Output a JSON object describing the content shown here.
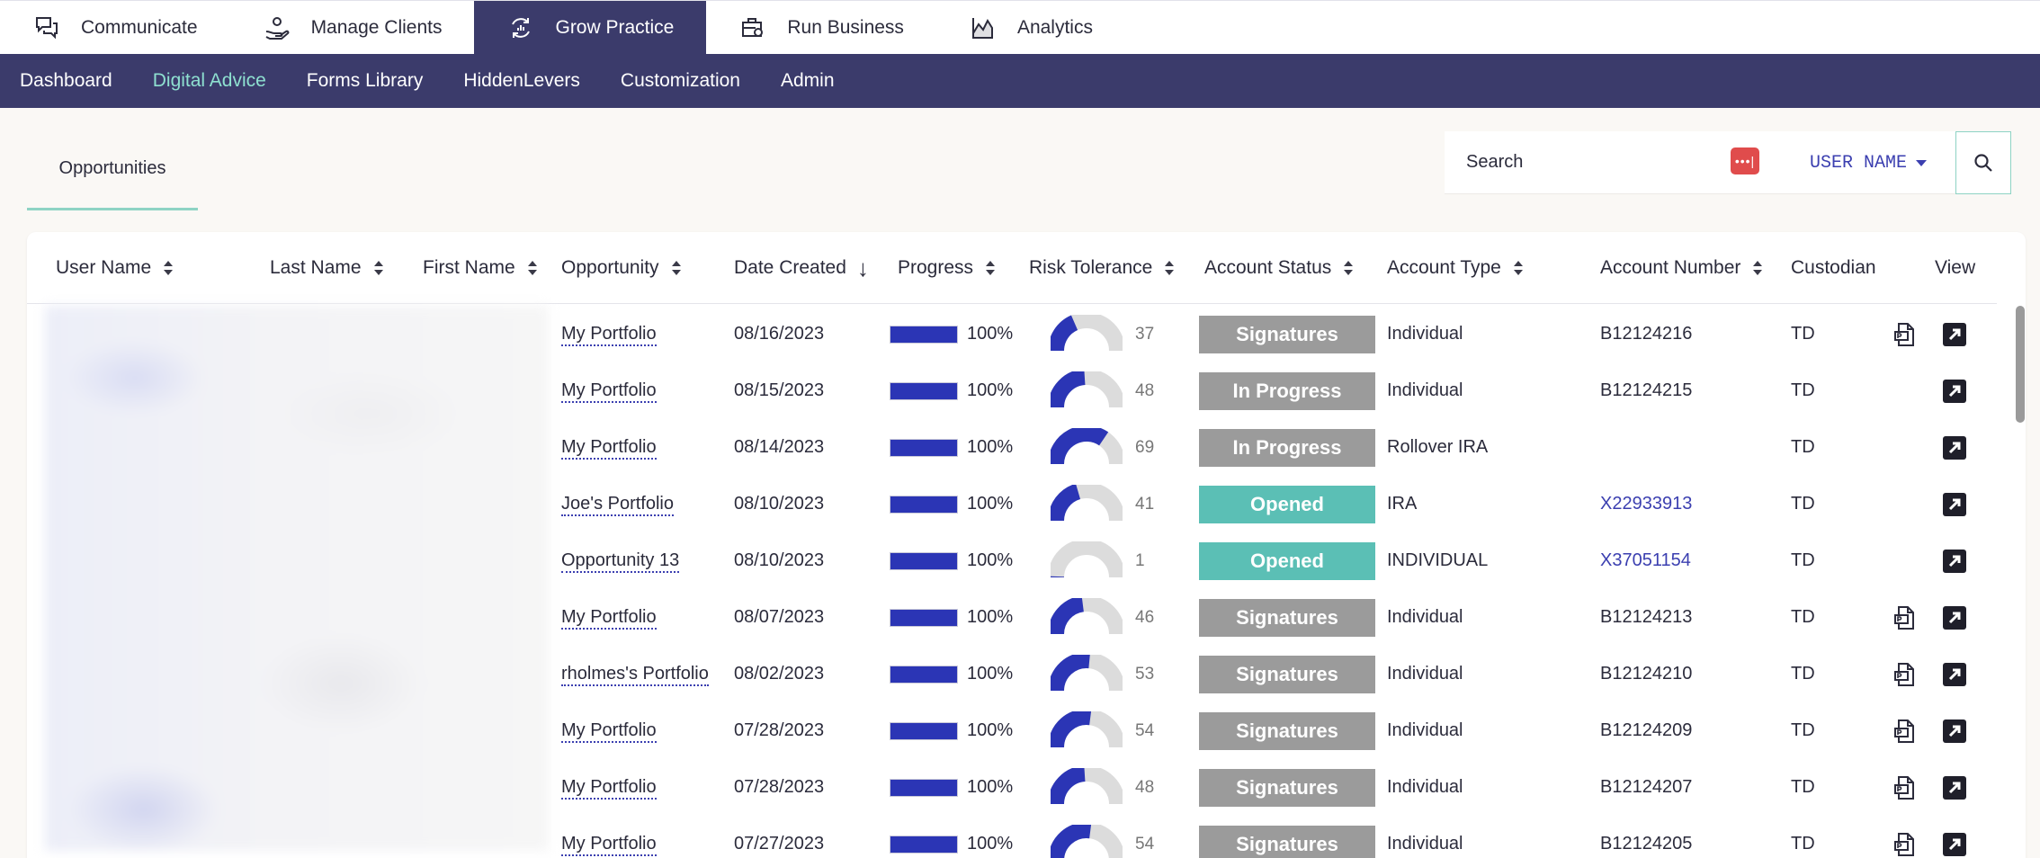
{
  "top_nav": {
    "tabs": [
      {
        "label": "Communicate",
        "icon": "chat-icon",
        "active": false
      },
      {
        "label": "Manage Clients",
        "icon": "hand-user-icon",
        "active": false
      },
      {
        "label": "Grow Practice",
        "icon": "growth-cycle-icon",
        "active": true
      },
      {
        "label": "Run Business",
        "icon": "business-gear-icon",
        "active": false
      },
      {
        "label": "Analytics",
        "icon": "analytics-chart-icon",
        "active": false
      }
    ]
  },
  "sub_nav": {
    "items": [
      {
        "label": "Dashboard",
        "active": false
      },
      {
        "label": "Digital Advice",
        "active": true
      },
      {
        "label": "Forms Library",
        "active": false
      },
      {
        "label": "HiddenLevers",
        "active": false
      },
      {
        "label": "Customization",
        "active": false
      },
      {
        "label": "Admin",
        "active": false
      }
    ]
  },
  "section_tab": {
    "label": "Opportunities"
  },
  "search": {
    "placeholder": "Search",
    "field": "USER NAME",
    "button_icon": "search-icon",
    "password_manager_icon": "password-manager-icon"
  },
  "table": {
    "columns": {
      "user_name": "User Name",
      "last_name": "Last Name",
      "first_name": "First Name",
      "opportunity": "Opportunity",
      "date_created": "Date Created",
      "progress": "Progress",
      "risk_tolerance": "Risk Tolerance",
      "account_status": "Account Status",
      "account_type": "Account Type",
      "account_number": "Account Number",
      "custodian": "Custodian",
      "view": "View"
    },
    "rows": [
      {
        "opportunity": "My Portfolio",
        "date": "08/16/2023",
        "progress": "100%",
        "risk": "37",
        "status": "Signatures",
        "type": "Individual",
        "account": "B12124216",
        "account_link": false,
        "custodian": "TD",
        "pdf": true
      },
      {
        "opportunity": "My Portfolio",
        "date": "08/15/2023",
        "progress": "100%",
        "risk": "48",
        "status": "In Progress",
        "type": "Individual",
        "account": "B12124215",
        "account_link": false,
        "custodian": "TD",
        "pdf": false
      },
      {
        "opportunity": "My Portfolio",
        "date": "08/14/2023",
        "progress": "100%",
        "risk": "69",
        "status": "In Progress",
        "type": "Rollover IRA",
        "account": "",
        "account_link": false,
        "custodian": "TD",
        "pdf": false
      },
      {
        "opportunity": "Joe's Portfolio",
        "date": "08/10/2023",
        "progress": "100%",
        "risk": "41",
        "status": "Opened",
        "type": "IRA",
        "account": "X22933913",
        "account_link": true,
        "custodian": "TD",
        "pdf": false
      },
      {
        "opportunity": "Opportunity 13",
        "date": "08/10/2023",
        "progress": "100%",
        "risk": "1",
        "status": "Opened",
        "type": "INDIVIDUAL",
        "account": "X37051154",
        "account_link": true,
        "custodian": "TD",
        "pdf": false
      },
      {
        "opportunity": "My Portfolio",
        "date": "08/07/2023",
        "progress": "100%",
        "risk": "46",
        "status": "Signatures",
        "type": "Individual",
        "account": "B12124213",
        "account_link": false,
        "custodian": "TD",
        "pdf": true
      },
      {
        "opportunity": "rholmes's Portfolio",
        "date": "08/02/2023",
        "progress": "100%",
        "risk": "53",
        "status": "Signatures",
        "type": "Individual",
        "account": "B12124210",
        "account_link": false,
        "custodian": "TD",
        "pdf": true
      },
      {
        "opportunity": "My Portfolio",
        "date": "07/28/2023",
        "progress": "100%",
        "risk": "54",
        "status": "Signatures",
        "type": "Individual",
        "account": "B12124209",
        "account_link": false,
        "custodian": "TD",
        "pdf": true
      },
      {
        "opportunity": "My Portfolio",
        "date": "07/28/2023",
        "progress": "100%",
        "risk": "48",
        "status": "Signatures",
        "type": "Individual",
        "account": "B12124207",
        "account_link": false,
        "custodian": "TD",
        "pdf": true
      },
      {
        "opportunity": "My Portfolio",
        "date": "07/27/2023",
        "progress": "100%",
        "risk": "54",
        "status": "Signatures",
        "type": "Individual",
        "account": "B12124205",
        "account_link": false,
        "custodian": "TD",
        "pdf": true
      }
    ]
  },
  "colors": {
    "nav_dark": "#3b3b6b",
    "accent_teal": "#8ed3c4",
    "status_gray": "#9b9b9b",
    "status_teal": "#5bbfb5",
    "bar_blue": "#2b35b5",
    "link_blue": "#3b3fb0"
  }
}
